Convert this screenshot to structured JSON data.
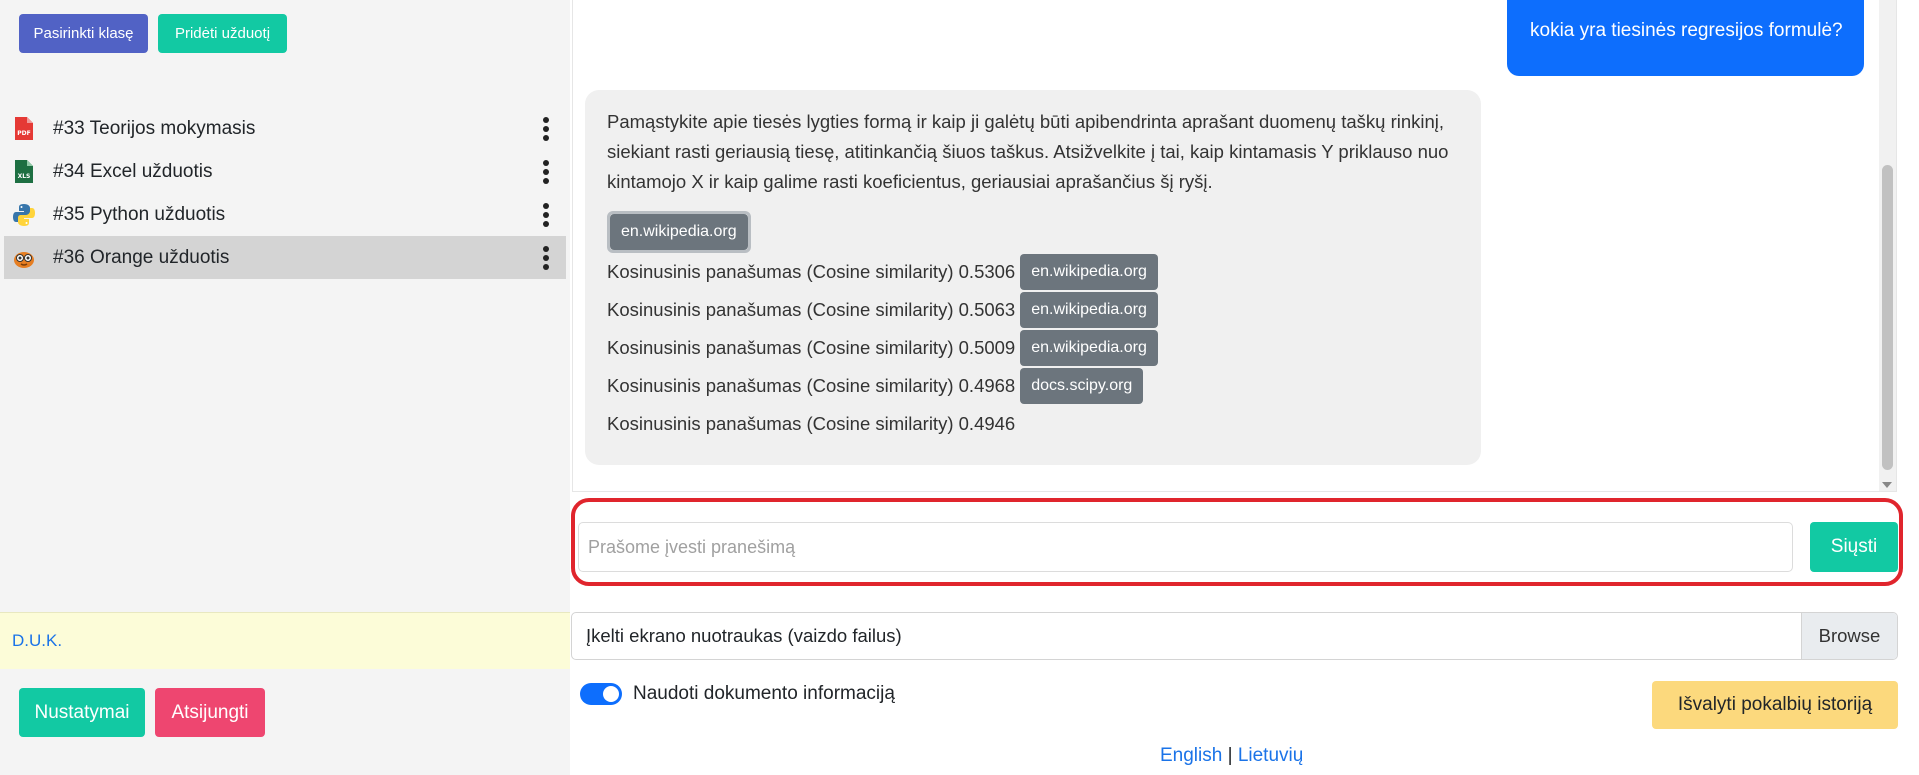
{
  "sidebar": {
    "select_class_label": "Pasirinkti klasę",
    "add_task_label": "Pridėti užduotį",
    "tasks": [
      {
        "label": "#33 Teorijos mokymasis",
        "icon": "pdf-icon"
      },
      {
        "label": "#34 Excel užduotis",
        "icon": "excel-icon"
      },
      {
        "label": "#35 Python užduotis",
        "icon": "python-icon"
      },
      {
        "label": "#36 Orange užduotis",
        "icon": "orange-icon"
      }
    ],
    "active_task_index": 3,
    "faq_label": "D.U.K.",
    "settings_label": "Nustatymai",
    "logout_label": "Atsijungti"
  },
  "chat": {
    "user_message": "kokia yra tiesinės regresijos formulė?",
    "bot_message": "Pamąstykite apie tiesės lygties formą ir kaip ji galėtų būti apibendrinta aprašant duomenų taškų rinkinį, siekiant rasti geriausią tiesę, atitinkančią šiuos taškus. Atsižvelkite į tai, kaip kintamasis Y priklauso nuo kintamojo X ir kaip galime rasti koeficientus, geriausiai aprašančius šį ryšį.",
    "first_source": "en.wikipedia.org",
    "similarity_prefix": "Kosinusinis panašumas (Cosine similarity)",
    "similarities": [
      {
        "score": "0.5306",
        "source": "en.wikipedia.org"
      },
      {
        "score": "0.5063",
        "source": "en.wikipedia.org"
      },
      {
        "score": "0.5009",
        "source": "en.wikipedia.org"
      },
      {
        "score": "0.4968",
        "source": "docs.scipy.org"
      },
      {
        "score": "0.4946",
        "source": ""
      }
    ]
  },
  "composer": {
    "placeholder": "Prašome įvesti pranešimą",
    "send_label": "Siųsti"
  },
  "upload": {
    "label": "Įkelti ekrano nuotraukas (vaizdo failus)",
    "browse_label": "Browse"
  },
  "options": {
    "use_document_label": "Naudoti dokumento informaciją",
    "use_document_enabled": true,
    "clear_history_label": "Išvalyti pokalbių istoriją"
  },
  "footer": {
    "lang_en": "English",
    "separator": "|",
    "lang_lt": "Lietuvių"
  },
  "colors": {
    "primary": "#0d6efd",
    "teal": "#12c9a3",
    "indigo": "#5162c5",
    "danger": "#ee4670",
    "warning": "#fcd97d",
    "highlight": "#e0252d"
  }
}
